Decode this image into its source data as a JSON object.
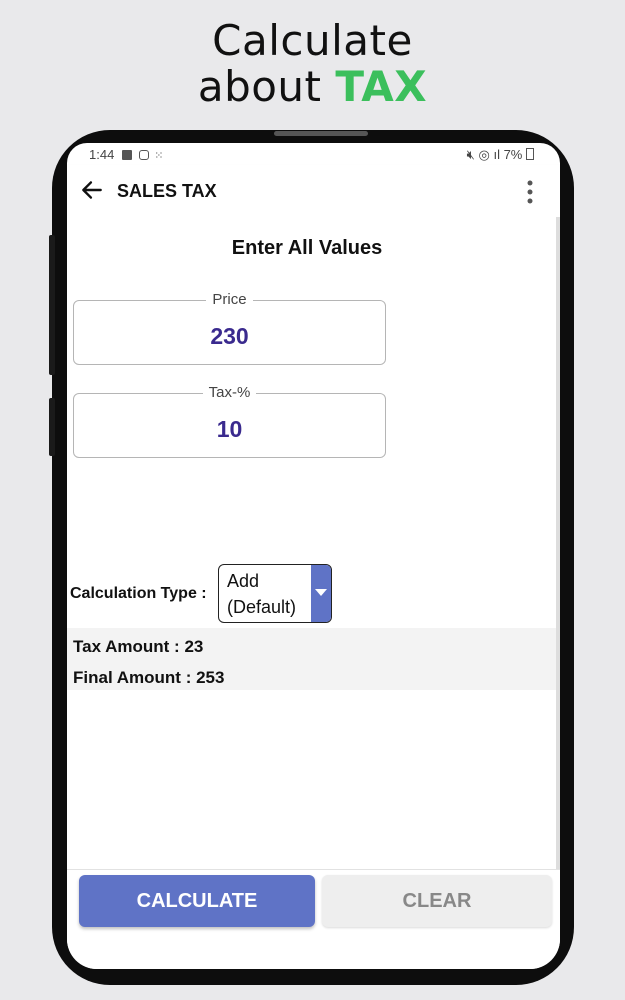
{
  "banner": {
    "line1": "Calculate",
    "line2_prefix": "about",
    "line2_accent": "TAX"
  },
  "status_bar": {
    "time": "1:44",
    "battery": "7%"
  },
  "app_bar": {
    "title": "SALES TAX"
  },
  "form": {
    "heading": "Enter All Values",
    "price": {
      "label": "Price",
      "value": "230"
    },
    "tax": {
      "label": "Tax-%",
      "value": "10"
    },
    "calc_type": {
      "label": "Calculation Type :",
      "selected_line1": "Add",
      "selected_line2": "(Default)"
    }
  },
  "results": {
    "tax_amount": "Tax Amount : 23",
    "final_amount": "Final Amount : 253"
  },
  "buttons": {
    "calculate": "CALCULATE",
    "clear": "CLEAR"
  },
  "colors": {
    "accent_green": "#3bbf5c",
    "primary_blue": "#5f73c6",
    "value_purple": "#3a2a8e"
  }
}
